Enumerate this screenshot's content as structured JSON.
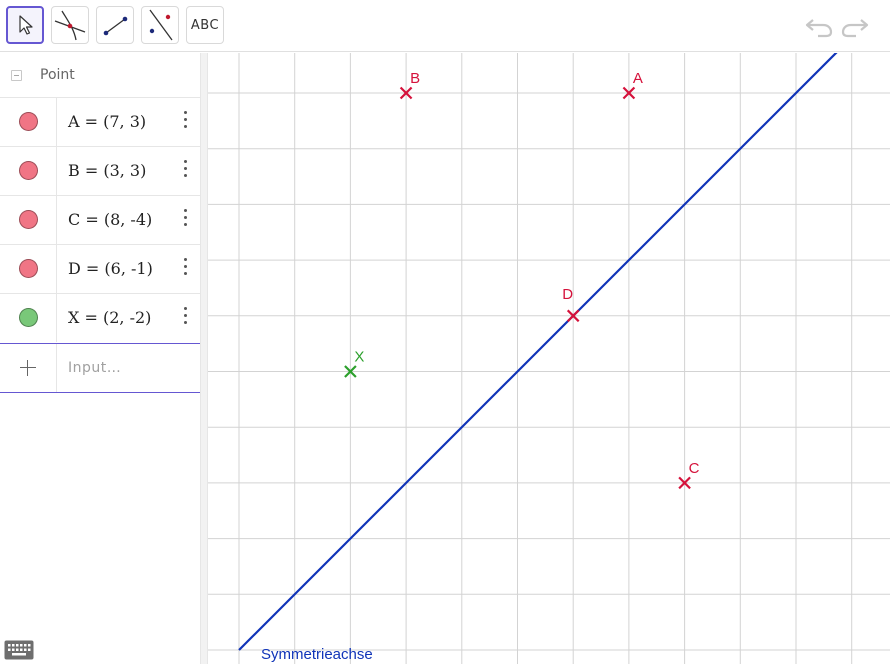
{
  "toolbar": {
    "tools": [
      {
        "name": "move-tool",
        "active": true
      },
      {
        "name": "intersect-tool",
        "active": false
      },
      {
        "name": "segment-tool",
        "active": false
      },
      {
        "name": "reflect-about-line-tool",
        "active": false
      },
      {
        "name": "text-tool",
        "label": "ABC",
        "active": false
      }
    ],
    "undo_icon": "undo-icon",
    "redo_icon": "redo-icon"
  },
  "algebra": {
    "group_title": "Point",
    "items": [
      {
        "label": "A = (7, 3)",
        "color": "#f07585"
      },
      {
        "label": "B = (3, 3)",
        "color": "#f07585"
      },
      {
        "label": "C = (8, -4)",
        "color": "#f07585"
      },
      {
        "label": "D = (6, -1)",
        "color": "#f07585"
      },
      {
        "label": "X = (2, -2)",
        "color": "#79c879"
      }
    ],
    "input_placeholder": "Input…"
  },
  "graphics": {
    "points": [
      {
        "name": "A",
        "x": 7,
        "y": 3,
        "color": "#d5123b"
      },
      {
        "name": "B",
        "x": 3,
        "y": 3,
        "color": "#d5123b"
      },
      {
        "name": "C",
        "x": 8,
        "y": -4,
        "color": "#d5123b"
      },
      {
        "name": "D",
        "x": 6,
        "y": -1,
        "color": "#d5123b"
      },
      {
        "name": "X",
        "x": 2,
        "y": -2,
        "color": "#2ca02c"
      }
    ],
    "line_label": "Symmetrieachse",
    "line_color": "#1034b8",
    "grid": true
  },
  "colors": {
    "accent": "#6557d2",
    "point_red": "#d5123b",
    "point_green": "#2ca02c",
    "line_blue": "#1034b8"
  }
}
